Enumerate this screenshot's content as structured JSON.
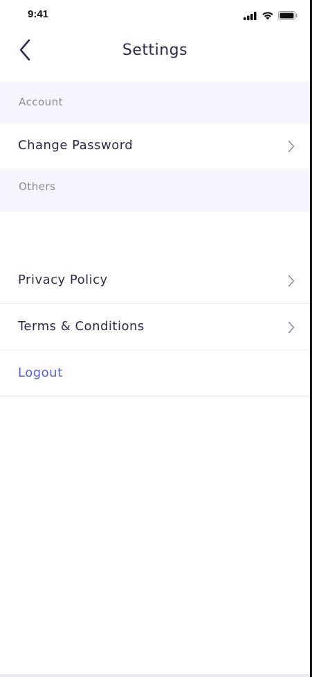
{
  "status_bar": {
    "time": "9:41",
    "icons": [
      "signal-icon",
      "wifi-icon",
      "battery-icon"
    ]
  },
  "nav": {
    "title": "Settings",
    "back_icon": "chevron-left-icon"
  },
  "sections": {
    "account": {
      "header": "Account",
      "items": [
        {
          "label": "Change Password",
          "icon": "chevron-right-icon"
        }
      ]
    },
    "others": {
      "header": "Others",
      "items": [
        {
          "label": "Privacy Policy",
          "icon": "chevron-right-icon"
        },
        {
          "label": "Terms & Conditions",
          "icon": "chevron-right-icon"
        }
      ]
    }
  },
  "logout": {
    "label": "Logout"
  },
  "colors": {
    "primary_text": "#2b2a4c",
    "section_bg": "#f5f6fd",
    "section_text": "#8a8a98",
    "accent": "#5260d0",
    "divider": "#ececf3"
  }
}
